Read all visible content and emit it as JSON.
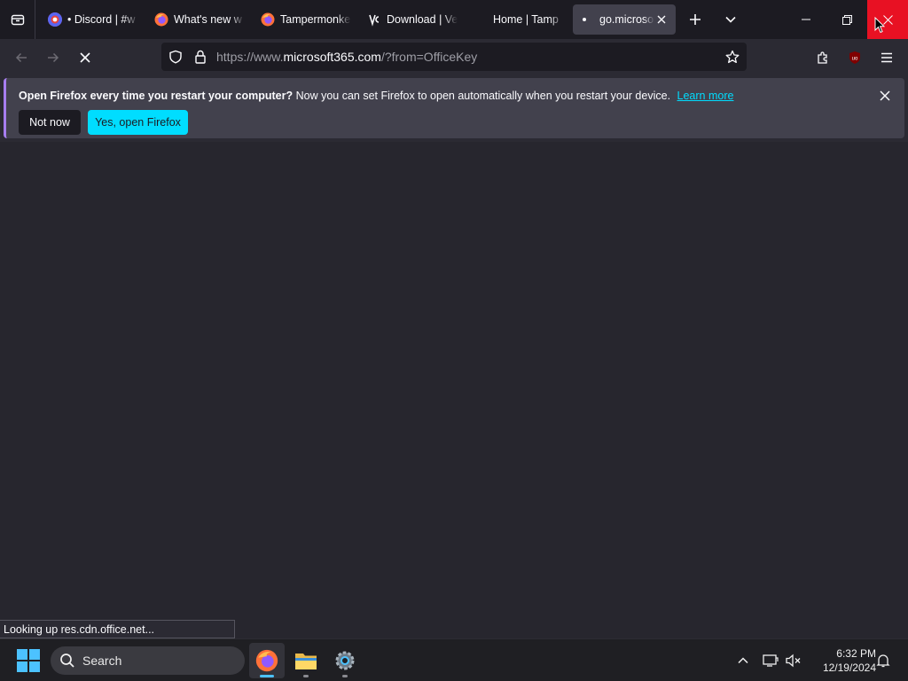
{
  "tabs": [
    {
      "title": "• Discord | #w",
      "icon": "discord-chrome-icon"
    },
    {
      "title": "What's new w",
      "icon": "firefox-icon"
    },
    {
      "title": "Tampermonke",
      "icon": "firefox-icon"
    },
    {
      "title": "Download | Ve",
      "icon": "vencord-icon"
    },
    {
      "title": "Home | Tamp",
      "icon": "none"
    },
    {
      "title": "go.microsoft",
      "icon": "loading-dot-icon",
      "active": true
    }
  ],
  "navbar": {
    "url_prefix": "https://www.",
    "url_domain": "microsoft365.com",
    "url_suffix": "/?from=OfficeKey"
  },
  "notification": {
    "title": "Open Firefox every time you restart your computer?",
    "message": "Now you can set Firefox to open automatically when you restart your device.",
    "link": "Learn more",
    "button_decline": "Not now",
    "button_accept": "Yes, open Firefox"
  },
  "status_text": "Looking up res.cdn.office.net...",
  "taskbar": {
    "search_label": "Search",
    "time": "6:32 PM",
    "date": "12/19/2024"
  },
  "colors": {
    "accent": "#00ddff",
    "close_hover": "#e81123",
    "windows_blue": "#4cc2ff"
  }
}
